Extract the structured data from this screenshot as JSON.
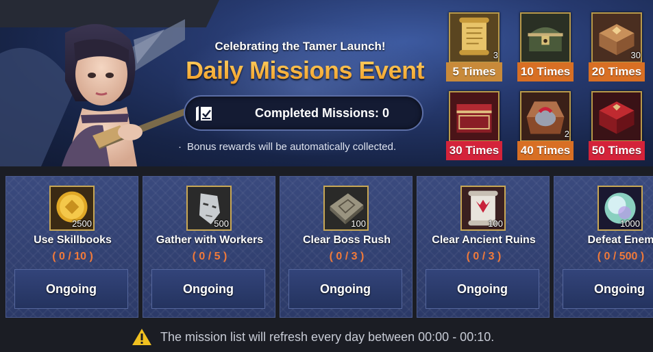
{
  "banner": {
    "subtitle": "Celebrating the Tamer Launch!",
    "title": "Daily Missions Event",
    "completed_label": "Completed Missions: 0",
    "bonus_note": "Bonus rewards will be automatically collected.",
    "rewards": [
      {
        "times": "5 Times",
        "qty": "3",
        "icon": "scroll-icon",
        "color": "#c88a3a"
      },
      {
        "times": "10 Times",
        "qty": "",
        "icon": "chest-icon",
        "color": "#d86f24"
      },
      {
        "times": "20 Times",
        "qty": "30",
        "icon": "ornate-box-icon",
        "color": "#d86f24"
      },
      {
        "times": "30 Times",
        "qty": "",
        "icon": "red-chest-icon",
        "color": "#d4233a"
      },
      {
        "times": "40 Times",
        "qty": "2",
        "icon": "helmet-box-icon",
        "color": "#d86f24"
      },
      {
        "times": "50 Times",
        "qty": "",
        "icon": "red-box-icon",
        "color": "#d4233a"
      }
    ]
  },
  "missions": [
    {
      "name": "Use Skillbooks",
      "progress": "( 0 / 10 )",
      "qty": "2500",
      "icon": "gold-coin-icon",
      "status": "Ongoing"
    },
    {
      "name": "Gather with Workers",
      "progress": "( 0 / 5 )",
      "qty": "500",
      "icon": "mask-icon",
      "status": "Ongoing"
    },
    {
      "name": "Clear Boss Rush",
      "progress": "( 0 / 3 )",
      "qty": "100",
      "icon": "stone-tablet-icon",
      "status": "Ongoing"
    },
    {
      "name": "Clear Ancient Ruins",
      "progress": "( 0 / 3 )",
      "qty": "100",
      "icon": "scroll-seal-icon",
      "status": "Ongoing"
    },
    {
      "name": "Defeat Enem",
      "progress": "( 0 / 500 )",
      "qty": "1000",
      "icon": "orb-icon",
      "status": "Ongoing"
    }
  ],
  "footer": {
    "note": "The mission list will refresh every day between 00:00 - 00:10."
  }
}
